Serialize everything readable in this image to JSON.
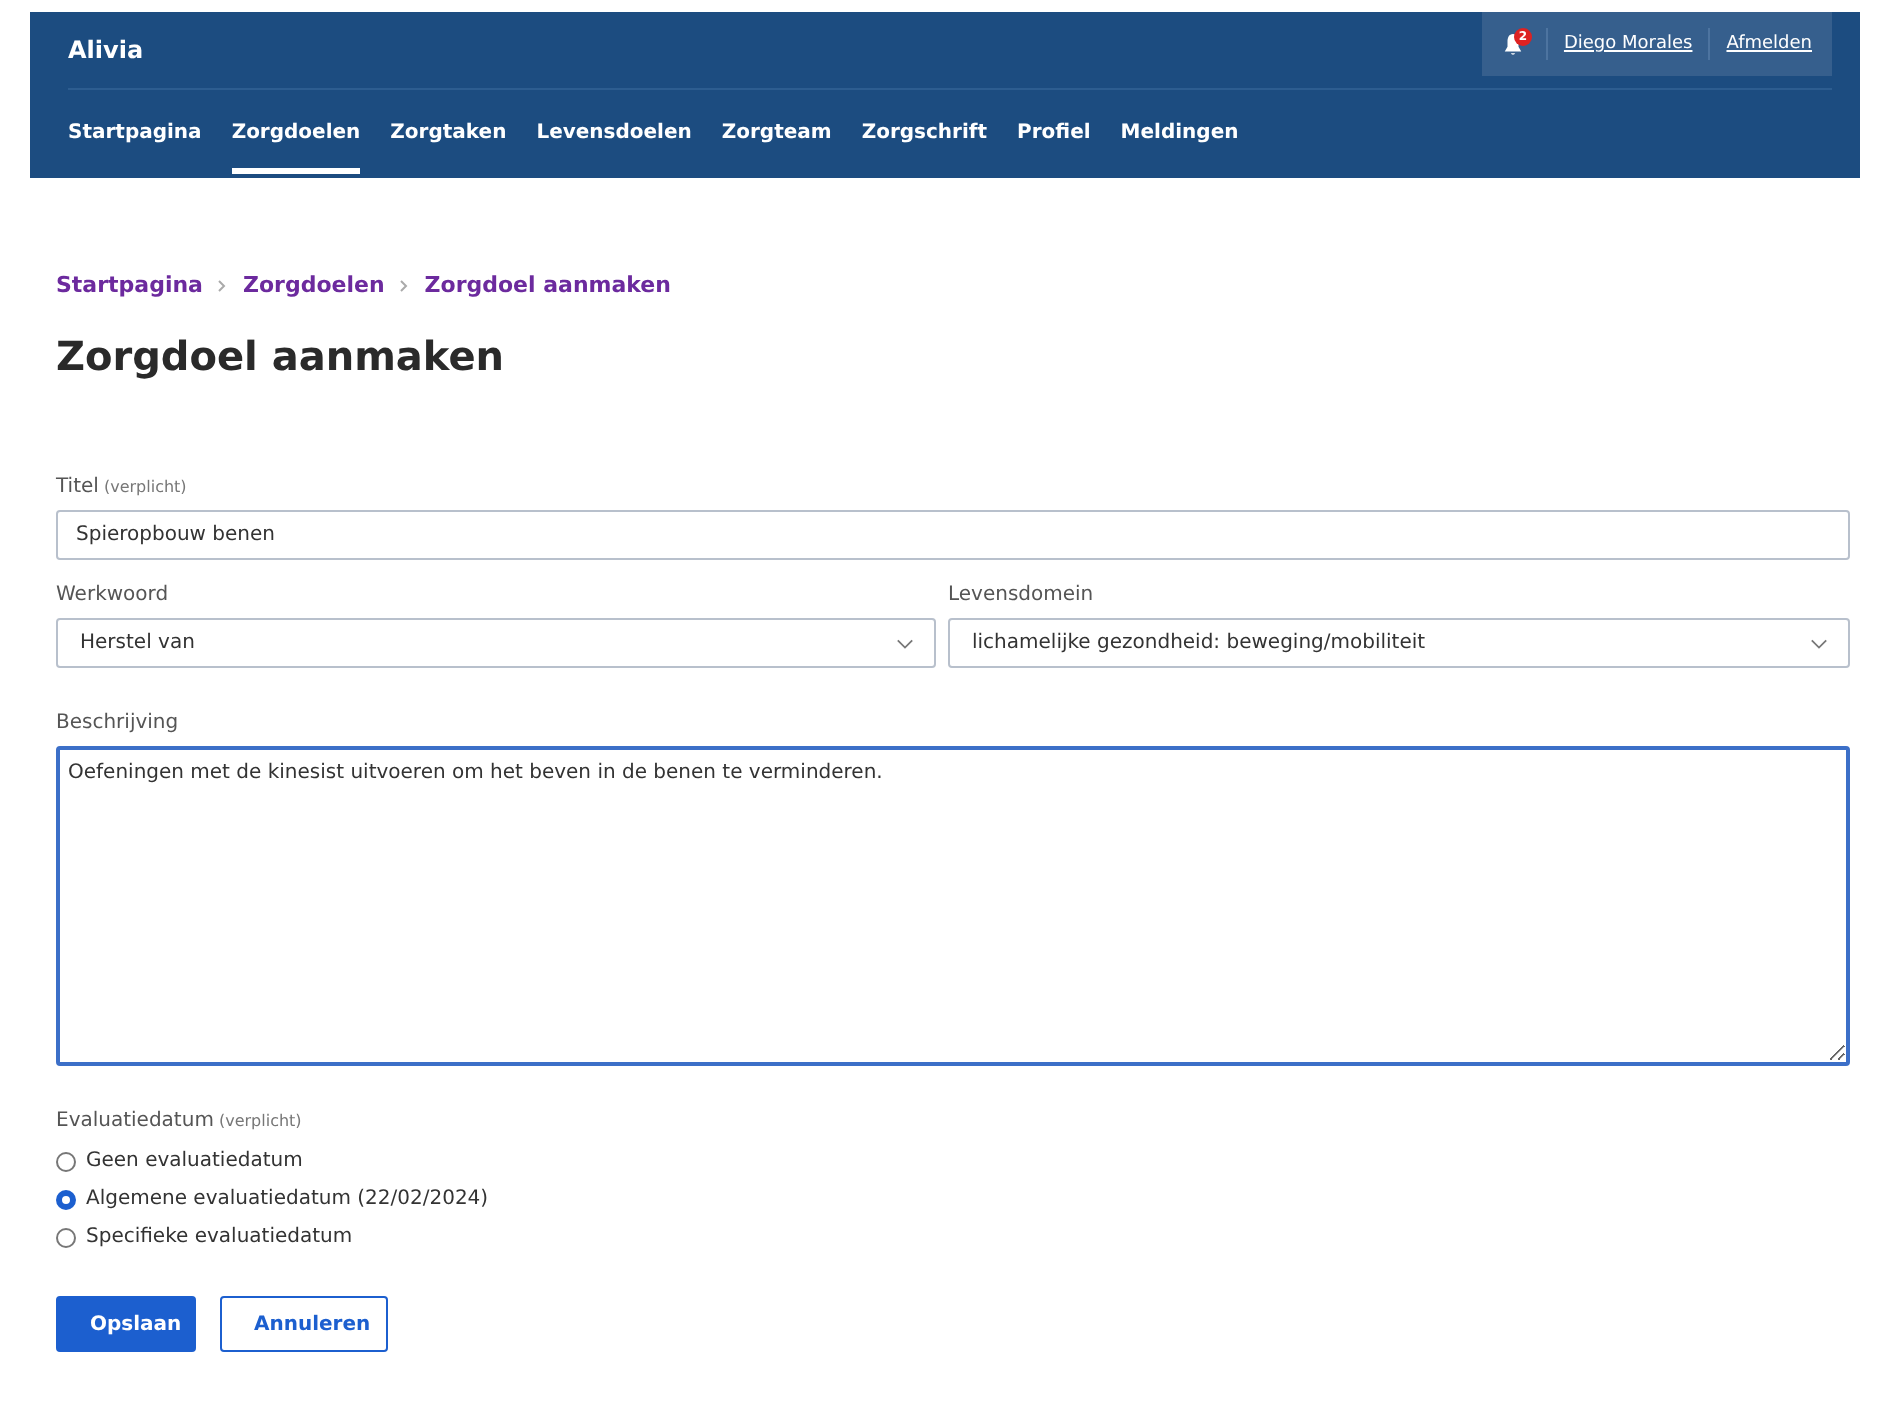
{
  "header": {
    "app_name": "Alivia",
    "notifications": {
      "count": "2"
    },
    "user": "Diego Morales",
    "logout": "Afmelden"
  },
  "nav": [
    {
      "label": "Startpagina",
      "selected": false
    },
    {
      "label": "Zorgdoelen",
      "selected": true
    },
    {
      "label": "Zorgtaken",
      "selected": false
    },
    {
      "label": "Levensdoelen",
      "selected": false
    },
    {
      "label": "Zorgteam",
      "selected": false
    },
    {
      "label": "Zorgschrift",
      "selected": false
    },
    {
      "label": "Profiel",
      "selected": false
    },
    {
      "label": "Meldingen",
      "selected": false
    }
  ],
  "breadcrumb": [
    "Startpagina",
    "Zorgdoelen",
    "Zorgdoel aanmaken"
  ],
  "title": "Zorgdoel aanmaken",
  "form": {
    "titel": {
      "label": "Titel",
      "hint": "(verplicht)",
      "value": "Spieropbouw benen"
    },
    "werkwoord": {
      "label": "Werkwoord",
      "value": "Herstel van"
    },
    "levensdomein": {
      "label": "Levensdomein",
      "value": "lichamelijke gezondheid: beweging/mobiliteit"
    },
    "beschrijving": {
      "label": "Beschrijving",
      "value": "Oefeningen met de kinesist uitvoeren om het beven in de benen te verminderen."
    },
    "evaluatiedatum": {
      "label": "Evaluatiedatum",
      "hint": "(verplicht)",
      "options": [
        {
          "label": "Geen evaluatiedatum",
          "selected": false
        },
        {
          "label": "Algemene evaluatiedatum (22/02/2024)",
          "selected": true
        },
        {
          "label": "Specifieke evaluatiedatum",
          "selected": false
        }
      ]
    }
  },
  "buttons": [
    {
      "label": "Opslaan",
      "kind": "primary"
    },
    {
      "label": "Annuleren",
      "kind": "secondary"
    }
  ]
}
